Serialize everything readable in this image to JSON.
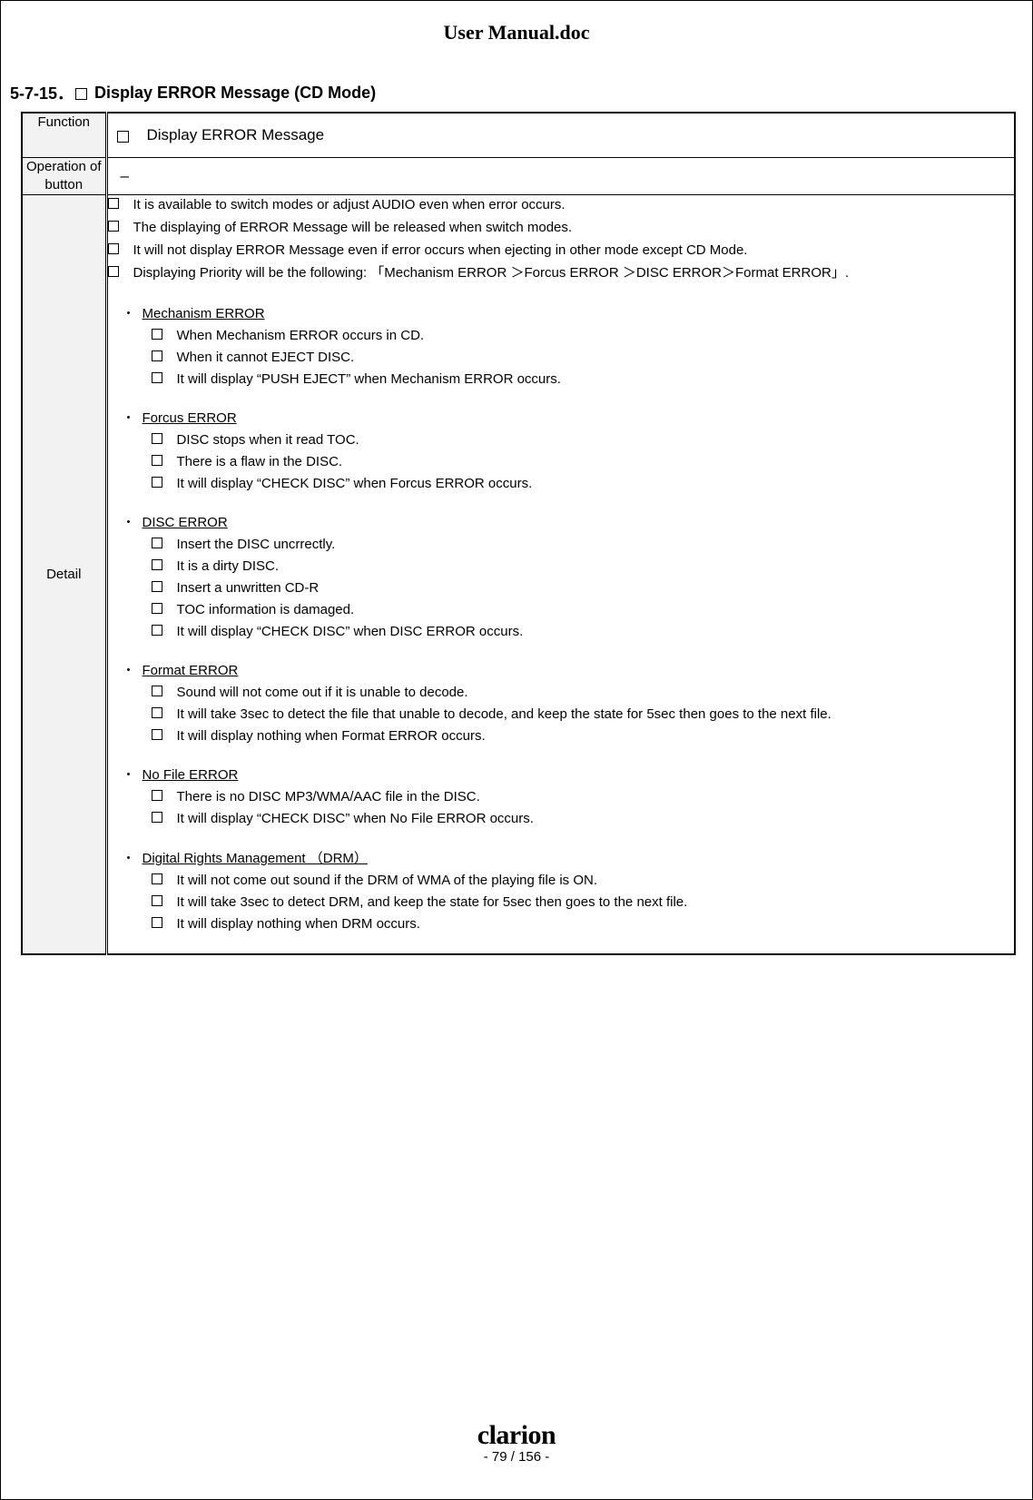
{
  "doc_title": "User Manual.doc",
  "section": {
    "number": "5-7-15．",
    "title": "Display ERROR Message (CD Mode)"
  },
  "table": {
    "function_label": "Function",
    "function_value": "Display ERROR Message",
    "operation_label": "Operation of button",
    "operation_value": "–",
    "detail_label": "Detail"
  },
  "top_items": [
    "It is available to switch modes or adjust AUDIO even when error occurs.",
    "The displaying of ERROR Message will be released when switch modes.",
    "It will not display ERROR Message even if error occurs when ejecting in other mode except CD Mode.",
    "Displaying Priority will be the following: 「Mechanism ERROR  ＞Forcus ERROR  ＞DISC ERROR＞Format ERROR」."
  ],
  "error_sections": [
    {
      "title": "Mechanism ERROR",
      "items": [
        "When Mechanism ERROR occurs in CD.",
        "When it cannot EJECT DISC.",
        "It will display “PUSH  EJECT” when Mechanism ERROR occurs."
      ]
    },
    {
      "title": "Forcus ERROR",
      "items": [
        "DISC stops when it read TOC.",
        "There is a flaw in the DISC.",
        "It will display “CHECK  DISC” when Forcus ERROR occurs."
      ]
    },
    {
      "title": "DISC ERROR",
      "items": [
        "Insert the DISC uncrrectly.",
        "It is a dirty DISC.",
        "Insert a unwritten CD-R",
        "TOC information is damaged.",
        "It will display “CHECK  DISC” when DISC ERROR occurs."
      ]
    },
    {
      "title": "Format ERROR",
      "items": [
        "Sound will not come out if it is unable to decode.",
        "It will take 3sec to detect the file that unable to decode, and keep the state for 5sec then goes to the next file.",
        "It will display nothing when Format ERROR occurs."
      ]
    },
    {
      "title": "No File ERROR",
      "items": [
        "There is no DISC MP3/WMA/AAC file in the DISC.",
        " It will display “CHECK  DISC” when No File ERROR occurs."
      ]
    },
    {
      "title": "Digital Rights Management （DRM）",
      "items": [
        "It will not come out sound if the DRM of WMA of the playing file is ON.",
        "It will take 3sec to detect DRM, and keep the state for 5sec then goes to the next file.",
        "It will display nothing when DRM occurs."
      ]
    }
  ],
  "footer": {
    "logo": "clarion",
    "page": "- 79 / 156 -"
  }
}
